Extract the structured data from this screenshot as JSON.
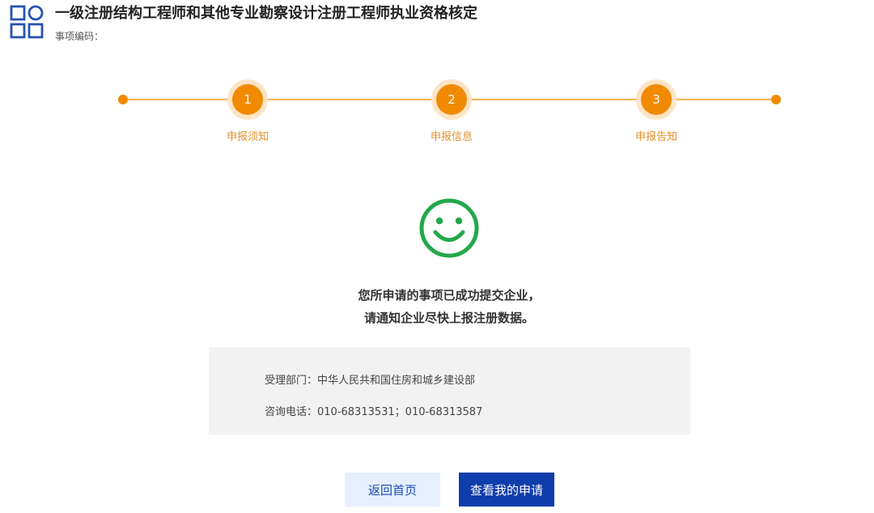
{
  "header": {
    "title": "一级注册结构工程师和其他专业勘察设计注册工程师执业资格核定",
    "subtitle": "事项编码："
  },
  "stepper": {
    "steps": [
      {
        "number": "1",
        "label": "申报须知"
      },
      {
        "number": "2",
        "label": "申报信息"
      },
      {
        "number": "3",
        "label": "申报告知"
      }
    ]
  },
  "result": {
    "icon": "smiley-icon",
    "line1": "您所申请的事项已成功提交企业，",
    "line2": "请通知企业尽快上报注册数据。"
  },
  "info": {
    "department": "受理部门：中华人民共和国住房和城乡建设部",
    "phone": "咨询电话：010-68313531；010-68313587"
  },
  "buttons": {
    "home": "返回首页",
    "view": "查看我的申请"
  },
  "colors": {
    "accent_orange": "#f08a00",
    "smiley_green": "#22a84a",
    "primary_blue": "#0f3dab"
  }
}
